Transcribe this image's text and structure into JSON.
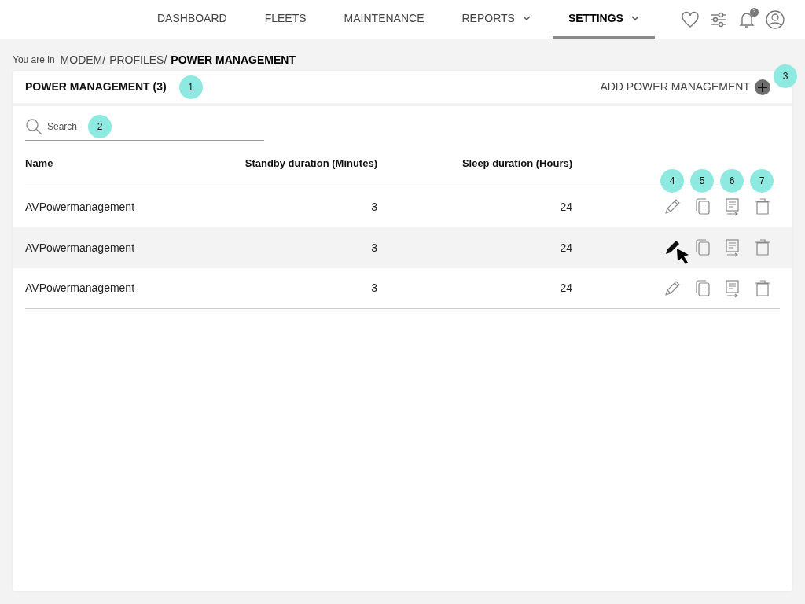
{
  "nav": {
    "items": [
      {
        "label": "DASHBOARD",
        "selected": false,
        "dropdown": false
      },
      {
        "label": "FLEETS",
        "selected": false,
        "dropdown": false
      },
      {
        "label": "MAINTENANCE",
        "selected": false,
        "dropdown": false
      },
      {
        "label": "REPORTS",
        "selected": false,
        "dropdown": true
      },
      {
        "label": "SETTINGS",
        "selected": true,
        "dropdown": true
      }
    ],
    "notification_count": "3"
  },
  "breadcrumb": {
    "prefix": "You are in",
    "path": [
      "MODEM/",
      "PROFILES/"
    ],
    "current": "POWER MANAGEMENT"
  },
  "panel": {
    "title": "POWER MANAGEMENT (3)",
    "title_callout": "1",
    "add_label": "ADD POWER MANAGEMENT",
    "add_callout": "3",
    "search": {
      "placeholder": "Search",
      "callout": "2"
    },
    "columns": [
      "Name",
      "Standby duration (Minutes)",
      "Sleep duration (Hours)"
    ],
    "action_callouts": [
      "4",
      "5",
      "6",
      "7"
    ],
    "rows": [
      {
        "name": "AVPowermanagement",
        "standby": "3",
        "sleep": "24",
        "hovered": false
      },
      {
        "name": "AVPowermanagement",
        "standby": "3",
        "sleep": "24",
        "hovered": true
      },
      {
        "name": "AVPowermanagement",
        "standby": "3",
        "sleep": "24",
        "hovered": false
      }
    ]
  }
}
